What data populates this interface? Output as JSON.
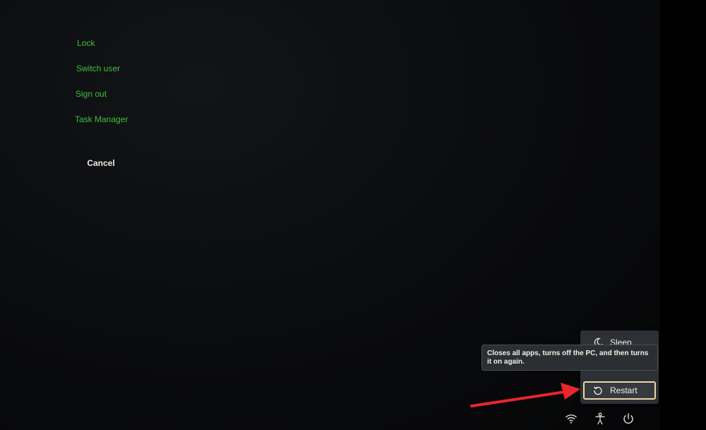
{
  "security_menu": {
    "items": [
      {
        "label": "Lock"
      },
      {
        "label": "Switch user"
      },
      {
        "label": "Sign out"
      },
      {
        "label": "Task Manager"
      }
    ],
    "cancel_label": "Cancel"
  },
  "power_menu": {
    "sleep_label": "Sleep",
    "restart_label": "Restart",
    "restart_tooltip": "Closes all apps, turns off the PC, and then turns it on again."
  },
  "system_tray": {
    "icons": [
      "wifi-icon",
      "accessibility-icon",
      "power-icon"
    ]
  },
  "colors": {
    "menu_text": "#3fbf3f",
    "restart_focus_border": "#e8d7a8",
    "annotation_arrow": "#e8262b"
  }
}
